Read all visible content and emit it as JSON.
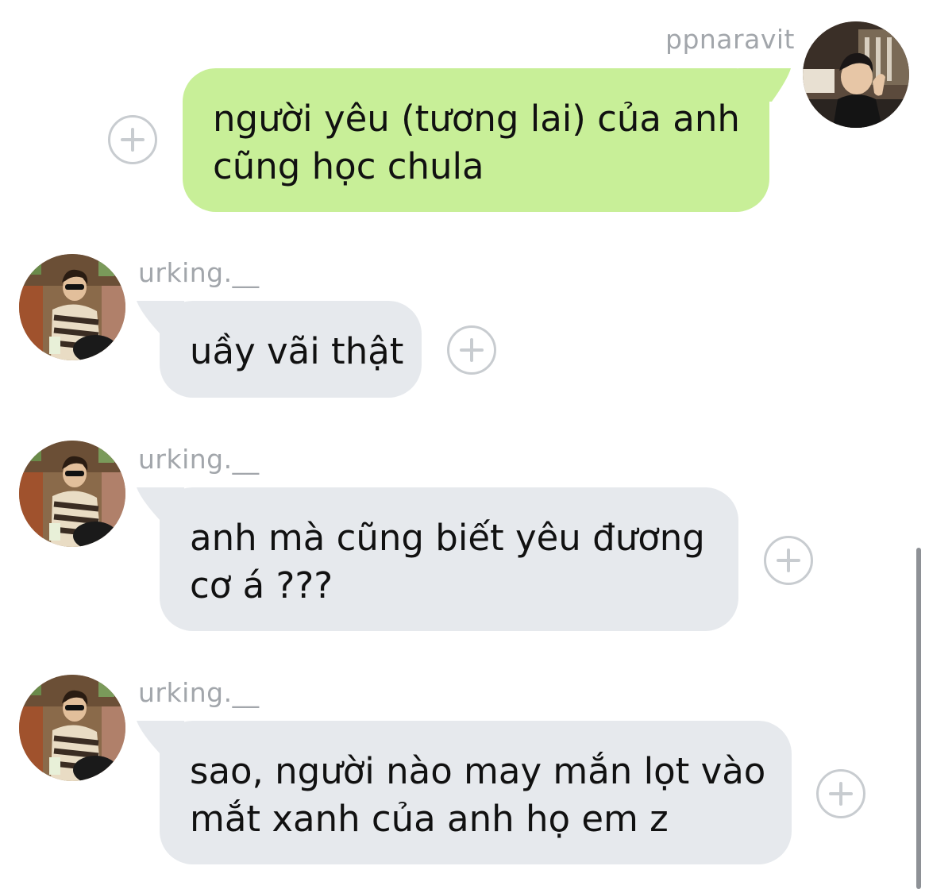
{
  "conversation": {
    "messages": [
      {
        "sender": "ppnaravit",
        "direction": "outgoing",
        "lines": [
          "người yêu (tương lai) của anh",
          "cũng học chula"
        ]
      },
      {
        "sender": "urking.__",
        "direction": "incoming",
        "lines": [
          "uầy vãi thật"
        ]
      },
      {
        "sender": "urking.__",
        "direction": "incoming",
        "lines": [
          "anh mà cũng biết yêu đương",
          "cơ á ???"
        ]
      },
      {
        "sender": "urking.__",
        "direction": "incoming",
        "lines": [
          "sao, người nào may mắn lọt vào",
          "mắt xanh của anh họ em z"
        ]
      }
    ]
  },
  "icons": {
    "reaction": "plus-circle-icon",
    "avatar_outgoing": "profile-photo-ppnaravit",
    "avatar_incoming": "profile-photo-urking"
  },
  "colors": {
    "outgoing_bubble": "#c8ef98",
    "incoming_bubble": "#e6e9ed",
    "sender_name": "#a2a6ab",
    "reaction_button": "#c8ccd0"
  }
}
